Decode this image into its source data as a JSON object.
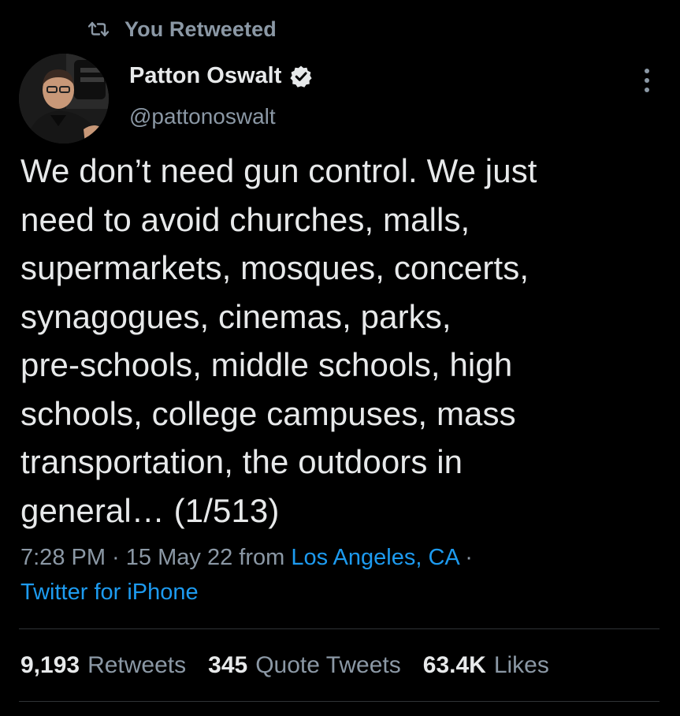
{
  "retweet_header": {
    "icon": "retweet-icon",
    "label": "You Retweeted"
  },
  "author": {
    "display_name": "Patton Oswalt",
    "handle": "@pattonoswalt",
    "verified_icon": "verified-badge-icon"
  },
  "tweet": {
    "text": "We don’t need gun control. We just\nneed to avoid churches, malls,\nsupermarkets, mosques, concerts,\nsynagogues, cinemas, parks,\npre-schools, middle schools, high\nschools, college campuses, mass\ntransportation, the outdoors in\ngeneral… (1/513)"
  },
  "meta": {
    "time": "7:28 PM",
    "sep1": " · ",
    "date": "15 May 22",
    "from": " from ",
    "location": "Los Angeles, CA",
    "sep2": " ·",
    "source": "Twitter for iPhone"
  },
  "stats": {
    "retweets_count": "9,193",
    "retweets_label": "Retweets",
    "quotes_count": "345",
    "quotes_label": "Quote Tweets",
    "likes_count": "63.4K",
    "likes_label": "Likes"
  },
  "colors": {
    "background": "#000000",
    "primary_text": "#e7e9ea",
    "secondary_text": "#8b98a5",
    "link": "#1d9bf0",
    "divider": "#2f3336"
  }
}
